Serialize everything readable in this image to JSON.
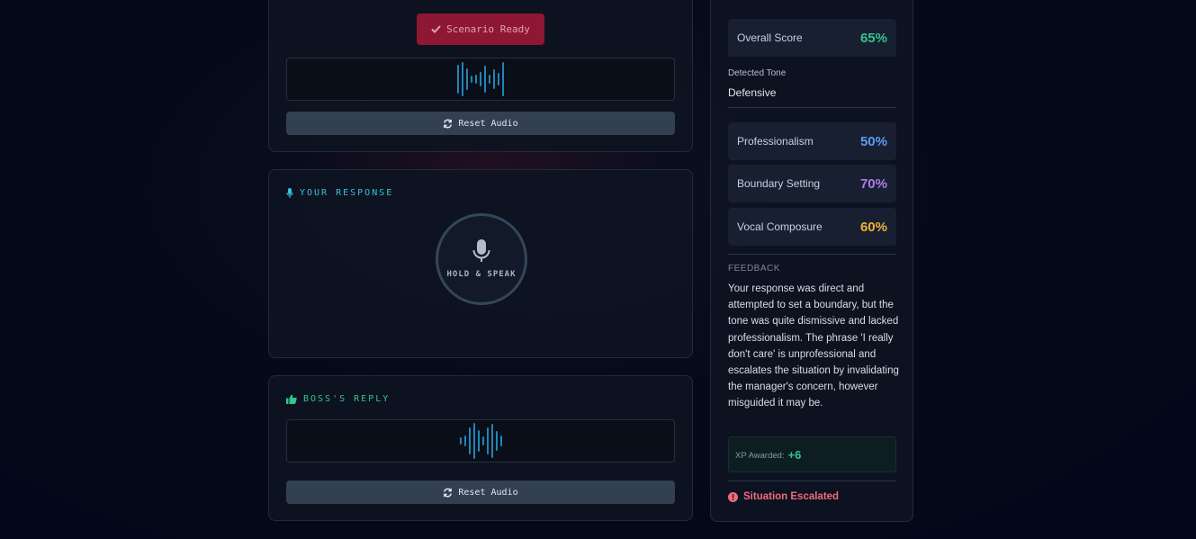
{
  "scenario": {
    "ready_label": "Scenario Ready",
    "reset_label": "Reset Audio"
  },
  "response": {
    "section_label": "YOUR RESPONSE",
    "mic_label": "HOLD & SPEAK"
  },
  "boss": {
    "section_label": "BOSS'S REPLY",
    "reset_label": "Reset Audio"
  },
  "analysis": {
    "overall": {
      "label": "Overall Score",
      "value": "65%",
      "color": "#32c48d"
    },
    "tone_label": "Detected Tone",
    "tone_value": "Defensive",
    "metrics": [
      {
        "label": "Professionalism",
        "value": "50%",
        "color": "#5b9bf0"
      },
      {
        "label": "Boundary Setting",
        "value": "70%",
        "color": "#b07ce8"
      },
      {
        "label": "Vocal Composure",
        "value": "60%",
        "color": "#efb23a"
      }
    ],
    "feedback_title": "FEEDBACK",
    "feedback_text": "Your response was direct and attempted to set a boundary, but the tone was quite dismissive and lacked professionalism. The phrase 'I really don't care' is unprofessional and escalates the situation by invalidating the manager's concern, however misguided it may be.",
    "xp_label": "XP Awarded:",
    "xp_value": "+6",
    "status": "Situation Escalated"
  },
  "colors": {
    "accent_cyan": "#34c3d9",
    "accent_green": "#32c48d",
    "waveform": "#1f86b5",
    "danger": "#ef6b7b"
  }
}
